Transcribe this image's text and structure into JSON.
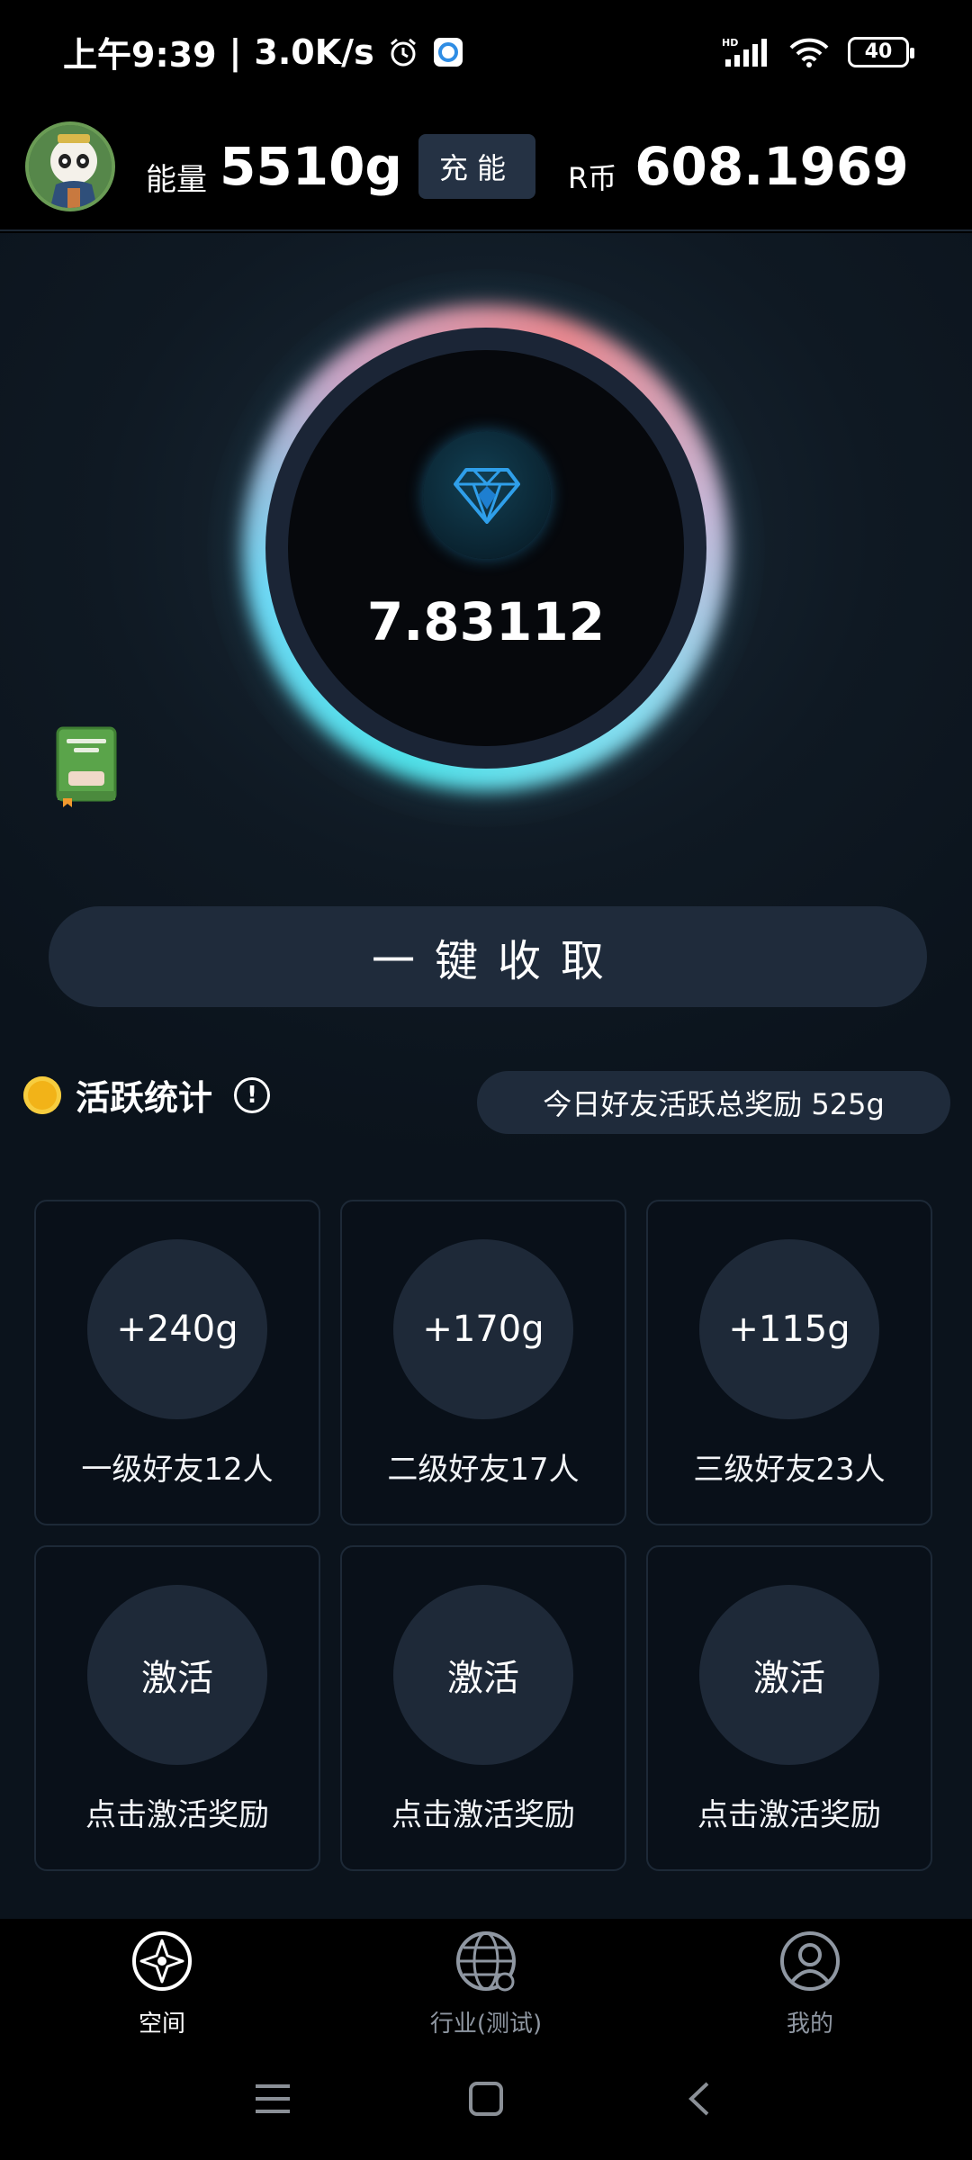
{
  "status_bar": {
    "time": "上午9:39",
    "separator": "|",
    "speed": "3.0K/s",
    "network_label": "HD",
    "battery": "40"
  },
  "header": {
    "energy_label": "能量",
    "energy_value": "5510g",
    "charge_label": "充能",
    "coin_label": "R币",
    "coin_value": "608.1969"
  },
  "orb": {
    "value": "7.83112"
  },
  "collect_button": "一键收取",
  "stats": {
    "title": "活跃统计",
    "info_symbol": "!",
    "today_reward": "今日好友活跃总奖励 525g"
  },
  "cards": [
    {
      "value": "+240g",
      "label": "一级好友12人"
    },
    {
      "value": "+170g",
      "label": "二级好友17人"
    },
    {
      "value": "+115g",
      "label": "三级好友23人"
    },
    {
      "value": "激活",
      "label": "点击激活奖励"
    },
    {
      "value": "激活",
      "label": "点击激活奖励"
    },
    {
      "value": "激活",
      "label": "点击激活奖励"
    }
  ],
  "nav": {
    "space": "空间",
    "industry": "行业(测试)",
    "mine": "我的"
  },
  "colors": {
    "background": "#0f1923",
    "card_circle": "#1e2938",
    "button": "#1f2b3b",
    "accent_gold": "#f2b318"
  }
}
